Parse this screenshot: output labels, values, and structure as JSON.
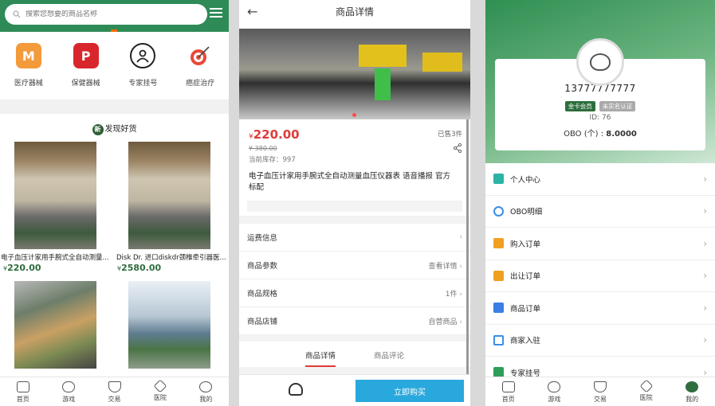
{
  "colors": {
    "brand_green": "#2e8b57",
    "price_red": "#e03a3a",
    "buy_blue": "#29a8dd"
  },
  "home": {
    "search_placeholder": "搜索您想要的商品名称",
    "categories": [
      {
        "label": "医疗器械",
        "icon": "m-logo-icon"
      },
      {
        "label": "保健器械",
        "icon": "pinterest-icon"
      },
      {
        "label": "专家挂号",
        "icon": "person-icon"
      },
      {
        "label": "癌症治疗",
        "icon": "target-icon"
      }
    ],
    "discover_badge": "新",
    "discover_title": "发现好货",
    "products": [
      {
        "name": "电子血压计家用手腕式全自动测量...",
        "currency": "¥",
        "price": "220.00"
      },
      {
        "name": "Disk Dr. 进口diskdr颈椎牵引器医...",
        "currency": "¥",
        "price": "2580.00"
      },
      {
        "name": "",
        "currency": "",
        "price": ""
      },
      {
        "name": "",
        "currency": "",
        "price": ""
      }
    ]
  },
  "tabbar": [
    {
      "label": "首页",
      "icon": "home-icon"
    },
    {
      "label": "游戏",
      "icon": "gamepad-icon"
    },
    {
      "label": "交易",
      "icon": "shield-icon"
    },
    {
      "label": "医院",
      "icon": "hospital-icon"
    },
    {
      "label": "我的",
      "icon": "user-icon"
    }
  ],
  "detail": {
    "back": "←",
    "title": "商品详情",
    "currency": "¥",
    "price": "220.00",
    "sold": "已售3件",
    "old_price": "¥ 380.00",
    "stock": "当前库存：997",
    "name": "电子血压计家用手腕式全自动测量血压仪器表 语音播报 官方标配",
    "rows": [
      {
        "label": "运费信息",
        "value": ""
      },
      {
        "label": "商品参数",
        "value": "查看详情"
      },
      {
        "label": "商品规格",
        "value": "1件"
      },
      {
        "label": "商品店铺",
        "value": "自营商品"
      }
    ],
    "tabs": [
      "商品详情",
      "商品评论"
    ],
    "buy": "立即购买"
  },
  "profile": {
    "phone": "13777777777",
    "badge_member": "金卡会员",
    "badge_verify": "未实名认证",
    "id": "ID: 76",
    "obo_label": "OBO (个) :",
    "obo_value": "8.0000",
    "menu": [
      {
        "label": "个人中心",
        "color": "#2bb3a4"
      },
      {
        "label": "OBO明细",
        "color": "#3a8ee6"
      },
      {
        "label": "购入订单",
        "color": "#f0a020"
      },
      {
        "label": "出让订单",
        "color": "#f0a020"
      },
      {
        "label": "商品订单",
        "color": "#3a7ee6"
      },
      {
        "label": "商家入驻",
        "color": "#3a8ee6"
      },
      {
        "label": "专家挂号",
        "color": "#2e9e5a"
      }
    ]
  }
}
